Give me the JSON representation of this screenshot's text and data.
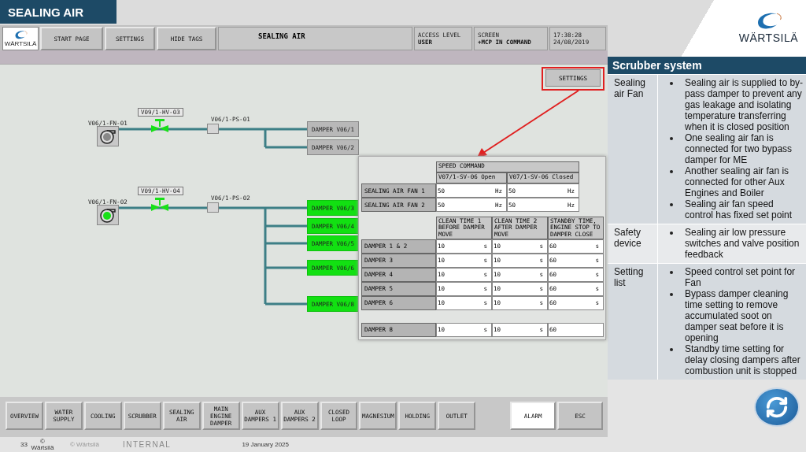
{
  "header": {
    "title": "SEALING AIR",
    "logo_text": "WÄRTSILÄ"
  },
  "hmi": {
    "top_bar": {
      "logo_text": "WÄRTSILÄ",
      "buttons": [
        "START PAGE",
        "SETTINGS",
        "HIDE TAGS"
      ],
      "title": "SEALING AIR",
      "access_level": {
        "label": "ACCESS LEVEL",
        "value": "USER"
      },
      "screen": {
        "label": "SCREEN",
        "value": "+MCP IN COMMAND"
      },
      "time": "17:38:28",
      "date": "24/08/2019"
    },
    "diagram": {
      "settings_button": "SETTINGS",
      "lines": [
        {
          "fan": "V06/1-FN-01",
          "fan_running": false,
          "valve": "V09/1-HV-03",
          "valve_open": true,
          "switch": "V06/1-PS-01",
          "dampers": [
            {
              "label": "DAMPER V06/1",
              "open": false
            },
            {
              "label": "DAMPER V06/2",
              "open": false
            }
          ]
        },
        {
          "fan": "V06/1-FN-02",
          "fan_running": true,
          "valve": "V09/1-HV-04",
          "valve_open": true,
          "switch": "V06/1-PS-02",
          "dampers": [
            {
              "label": "DAMPER V06/3",
              "open": true
            },
            {
              "label": "DAMPER V06/4",
              "open": true
            },
            {
              "label": "DAMPER V06/5",
              "open": true
            },
            {
              "label": "DAMPER V06/6",
              "open": true
            },
            {
              "label": "DAMPER V06/8",
              "open": true
            }
          ]
        }
      ]
    },
    "settings_popup": {
      "speed_table": {
        "heading": "SPEED COMMAND",
        "columns": [
          "V07/1-SV-06 Open",
          "V07/1-SV-06 Closed"
        ],
        "rows": [
          {
            "label": "SEALING AIR FAN 1",
            "cells": [
              {
                "value": "50",
                "unit": "Hz"
              },
              {
                "value": "50",
                "unit": "Hz"
              }
            ]
          },
          {
            "label": "SEALING AIR FAN 2",
            "cells": [
              {
                "value": "50",
                "unit": "Hz"
              },
              {
                "value": "50",
                "unit": "Hz"
              }
            ]
          }
        ]
      },
      "time_table": {
        "columns": [
          "CLEAN TIME 1 BEFORE DAMPER MOVE",
          "CLEAN TIME 2 AFTER DAMPER MOVE",
          "STANDBY TIME, ENGINE STOP TO DAMPER CLOSE"
        ],
        "rows": [
          {
            "label": "DAMPER 1 & 2",
            "cells": [
              {
                "value": "10",
                "unit": "s"
              },
              {
                "value": "10",
                "unit": "s"
              },
              {
                "value": "60",
                "unit": "s"
              }
            ]
          },
          {
            "label": "DAMPER 3",
            "cells": [
              {
                "value": "10",
                "unit": "s"
              },
              {
                "value": "10",
                "unit": "s"
              },
              {
                "value": "60",
                "unit": "s"
              }
            ]
          },
          {
            "label": "DAMPER 4",
            "cells": [
              {
                "value": "10",
                "unit": "s"
              },
              {
                "value": "10",
                "unit": "s"
              },
              {
                "value": "60",
                "unit": "s"
              }
            ]
          },
          {
            "label": "DAMPER 5",
            "cells": [
              {
                "value": "10",
                "unit": "s"
              },
              {
                "value": "10",
                "unit": "s"
              },
              {
                "value": "60",
                "unit": "s"
              }
            ]
          },
          {
            "label": "DAMPER 6",
            "cells": [
              {
                "value": "10",
                "unit": "s"
              },
              {
                "value": "10",
                "unit": "s"
              },
              {
                "value": "60",
                "unit": "s"
              }
            ]
          }
        ],
        "extra_rows": [
          {
            "label": "DAMPER 8",
            "cells": [
              {
                "value": "10",
                "unit": "s"
              },
              {
                "value": "10",
                "unit": "s"
              },
              {
                "value": "60"
              }
            ]
          }
        ]
      }
    },
    "bottom_nav": {
      "items": [
        "OVERVIEW",
        "WATER SUPPLY",
        "COOLING",
        "SCRUBBER",
        "SEALING AIR",
        "MAIN ENGINE DAMPER",
        "AUX DAMPERS 1",
        "AUX DAMPERS 2",
        "CLOSED LOOP",
        "MAGNESIUM",
        "HOLDING",
        "OUTLET"
      ],
      "actions": [
        {
          "label": "ALARM",
          "highlighted": true
        },
        {
          "label": "ESC",
          "highlighted": false
        }
      ]
    }
  },
  "side_panel": {
    "title": "Scrubber system",
    "rows": [
      {
        "label": "Sealing air Fan",
        "bullets": [
          "Sealing air is supplied to by-pass damper to prevent any gas leakage and isolating temperature transferring when it is closed position",
          "One sealing air fan is connected for two bypass damper for ME",
          "Another sealing air fan is connected for other Aux Engines and Boiler",
          "Sealing air fan speed control has fixed set point"
        ]
      },
      {
        "label": "Safety device",
        "bullets": [
          "Sealing air low pressure switches and valve position feedback"
        ]
      },
      {
        "label": "Setting list",
        "bullets": [
          "Speed control set point for Fan",
          "Bypass damper cleaning time setting to remove accumulated soot on damper seat before it is opening",
          "Standby time setting for delay closing dampers after combustion unit is stopped"
        ]
      }
    ]
  },
  "footer": {
    "page_number": "33",
    "copyright_1": "©",
    "copyright_2": "Wärtsilä",
    "copyright_3": "© Wärtsilä",
    "classification": "INTERNAL",
    "date": "19 January 2025"
  }
}
